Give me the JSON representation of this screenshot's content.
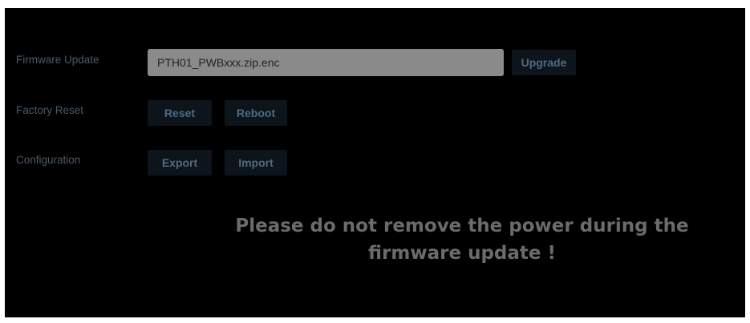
{
  "firmware": {
    "label": "Firmware Update",
    "file_value": "PTH01_PWBxxx.zip.enc",
    "upgrade_label": "Upgrade"
  },
  "factory_reset": {
    "label": "Factory Reset",
    "reset_label": "Reset",
    "reboot_label": "Reboot"
  },
  "configuration": {
    "label": "Configuration",
    "export_label": "Export",
    "import_label": "Import"
  },
  "warning": {
    "line1": "Please do not remove the power during the",
    "line2": "firmware update !"
  },
  "colors": {
    "background": "#000000",
    "label_text": "#4d5a66",
    "button_bg": "#0d141b",
    "button_text": "#4e6b83",
    "field_bg": "#8a8a8a",
    "warning_text": "#6b6b6b"
  }
}
